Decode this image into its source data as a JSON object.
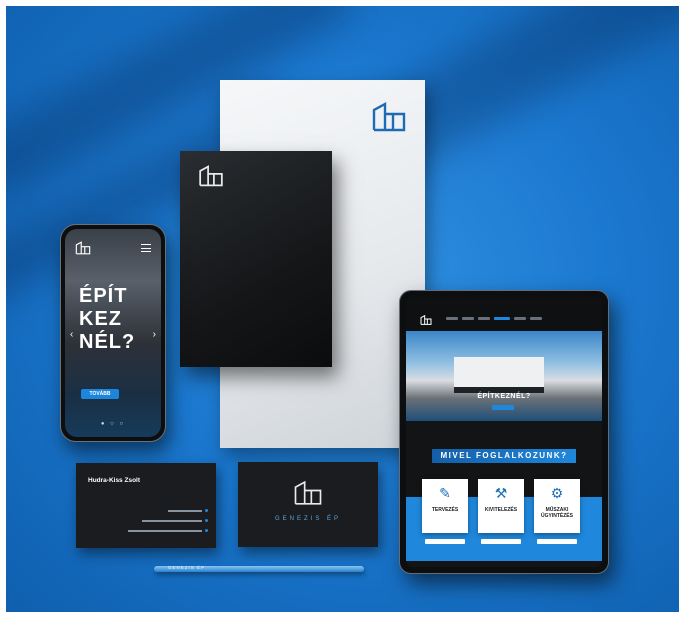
{
  "scene": {
    "background_color": "#1b78cf",
    "accent_color": "#1f88dc"
  },
  "phone": {
    "headline_lines": [
      "ÉPÍT",
      "KEZ",
      "NÉL?"
    ],
    "cta_label": "TOVÁBB",
    "slider_dots": "● ○ ○"
  },
  "business_card_front": {
    "name": "Hudra-Kiss Zsolt"
  },
  "business_card_back": {
    "brand": "GENEZIS ÉP"
  },
  "pencil": {
    "label": "GENEZIS ÉP"
  },
  "tablet": {
    "hero_title": "ÉPÍTKEZNÉL?",
    "section_title": "MIVEL FOGLALKOZUNK?",
    "services": [
      {
        "label": "TERVEZÉS",
        "icon": "pencil-ruler-icon",
        "glyph": "✎"
      },
      {
        "label": "KIVITELEZÉS",
        "icon": "tools-icon",
        "glyph": "⚒"
      },
      {
        "label": "MŰSZAKI ÜGYINTÉZÉS",
        "icon": "gears-icon",
        "glyph": "⚙"
      }
    ]
  }
}
